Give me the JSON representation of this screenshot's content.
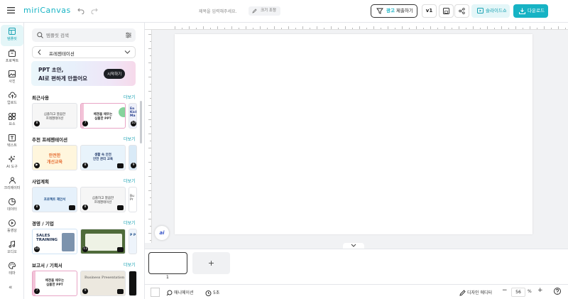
{
  "app": {
    "logo": "miriCanvas",
    "doc_title_placeholder": "제목을 입력해주세요.",
    "resize_label": "크기 조정"
  },
  "toolbar": {
    "ad_badge": "광고",
    "submit_label": "제출하기",
    "version": "v1",
    "slideshow": "슬라이드쇼",
    "download": "다운로드"
  },
  "rail": [
    {
      "label": "템플릿",
      "icon": "template-icon"
    },
    {
      "label": "프로젝트",
      "icon": "project-icon"
    },
    {
      "label": "사진",
      "icon": "photo-icon"
    },
    {
      "label": "업로드",
      "icon": "upload-icon"
    },
    {
      "label": "요소",
      "icon": "elements-icon"
    },
    {
      "label": "텍스트",
      "icon": "text-icon"
    },
    {
      "label": "AI 도구",
      "icon": "ai-tools-icon"
    },
    {
      "label": "크리에이터",
      "icon": "creator-icon"
    },
    {
      "label": "데이터",
      "icon": "data-icon"
    },
    {
      "label": "동영상",
      "icon": "video-icon"
    },
    {
      "label": "오디오",
      "icon": "audio-icon"
    },
    {
      "label": "테마",
      "icon": "theme-icon"
    }
  ],
  "panel": {
    "search_placeholder": "템플릿 검색",
    "category": "프레젠테이션",
    "banner": {
      "line1": "PPT 초안,",
      "line2": "AI로 편하게 만들어요",
      "cta": "시작하기"
    },
    "more_label": "더보기",
    "sections": [
      {
        "title": "최근사용",
        "thumbs": [
          {
            "num": "8",
            "caption": "심플하고 깔끔한\n프레젠테이션"
          },
          {
            "num": "7",
            "caption": "배경을 채우는\n심플한 PPT"
          },
          {
            "num": "10",
            "caption": "En Kick Ma"
          }
        ]
      },
      {
        "title": "추천 프레젠테이션",
        "thumbs": [
          {
            "num": "",
            "caption": "안전한\n개선교육"
          },
          {
            "num": "8",
            "caption": "생활 속 안전\n안전 관리 교육"
          },
          {
            "num": "9",
            "caption": ""
          }
        ]
      },
      {
        "title": "사업계획",
        "thumbs": [
          {
            "num": "8",
            "caption": "프로젝트 제안서"
          },
          {
            "num": "8",
            "caption": "심플하고 깔끔한\n프레젠테이션"
          },
          {
            "num": "",
            "caption": "Bu Pr"
          }
        ]
      },
      {
        "title": "경영 / 기업",
        "thumbs": [
          {
            "num": "10",
            "caption": "SALES TRAINING"
          },
          {
            "num": "11",
            "caption": ""
          },
          {
            "num": "",
            "caption": "P P"
          }
        ]
      },
      {
        "title": "보고서 / 기획서",
        "thumbs": [
          {
            "num": "7",
            "caption": "배경을 채우는\n심플한 PPT"
          },
          {
            "num": "9",
            "caption": "Business Presentation"
          },
          {
            "num": "",
            "caption": ""
          }
        ]
      }
    ]
  },
  "filmstrip": {
    "slide_number": "1"
  },
  "bottom": {
    "animation": "애니메이션",
    "duration": "5초",
    "design_editor": "디자인 에디터",
    "zoom": "56",
    "zoom_unit": "%"
  },
  "colors": {
    "accent": "#17b3c4",
    "dark": "#1d1f24"
  }
}
